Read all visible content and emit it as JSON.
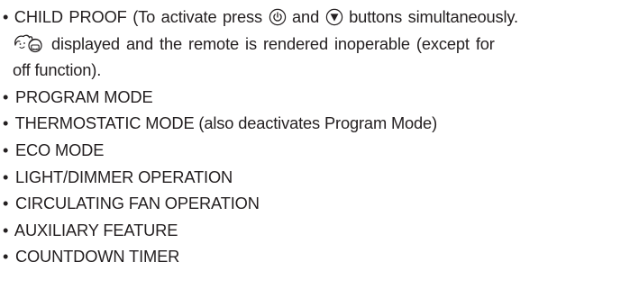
{
  "first_item": {
    "bullet": "•",
    "line1_a": "CHILD PROOF (To activate press",
    "line1_b": "and",
    "line1_c": "buttons simultaneously.",
    "line2": "displayed and the remote is rendered inoperable (except for",
    "line3": "off function).",
    "icons": [
      "power-button-icon",
      "down-arrow-button-icon",
      "child-lock-icon"
    ]
  },
  "items": [
    {
      "bullet": "•",
      "text": "PROGRAM MODE"
    },
    {
      "bullet": "•",
      "text": "THERMOSTATIC MODE (also deactivates Program Mode)"
    },
    {
      "bullet": "•",
      "text": "ECO MODE"
    },
    {
      "bullet": "•",
      "text": "LIGHT/DIMMER OPERATION"
    },
    {
      "bullet": "•",
      "text": "CIRCULATING FAN OPERATION"
    },
    {
      "bullet": "•",
      "text": "AUXILIARY FEATURE"
    },
    {
      "bullet": "•",
      "text": "COUNTDOWN TIMER"
    }
  ],
  "colors": {
    "text": "#231f20"
  }
}
